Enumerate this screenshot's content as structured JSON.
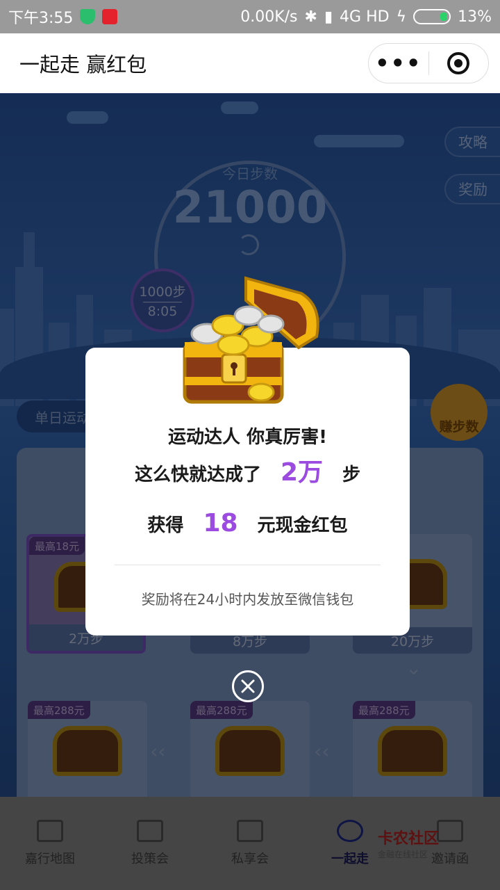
{
  "status_bar": {
    "time": "下午3:55",
    "network_speed": "0.00K/s",
    "network_type": "4G HD",
    "battery": "13%"
  },
  "title_bar": {
    "title": "一起走 赢红包",
    "more_icon": "more-dots-icon",
    "close_icon": "target-close-icon"
  },
  "background": {
    "step_label": "今日步数",
    "step_count": "21000",
    "side_buttons": [
      "攻略",
      "奖励"
    ],
    "milestone_steps": "1000步",
    "milestone_time": "8:05",
    "tab_label": "单日运动",
    "earn_button": "赚步数",
    "chest_cards": [
      {
        "tag": "最高18元",
        "steps": "2万步"
      },
      {
        "tag": "",
        "steps": "8万步"
      },
      {
        "tag": "",
        "steps": "20万步"
      },
      {
        "tag": "最高288元",
        "steps": ""
      },
      {
        "tag": "最高288元",
        "steps": ""
      },
      {
        "tag": "最高288元",
        "steps": ""
      }
    ]
  },
  "tab_bar": {
    "items": [
      {
        "label": "嘉行地图",
        "icon": "map-icon"
      },
      {
        "label": "投策会",
        "icon": "group-icon"
      },
      {
        "label": "私享会",
        "icon": "chat-icon"
      },
      {
        "label": "一起走",
        "icon": "walk-icon"
      },
      {
        "label": "邀请函",
        "icon": "mail-icon"
      }
    ],
    "active_index": 3
  },
  "watermark": {
    "name": "卡农社区",
    "sub": "金融在线社区"
  },
  "dialog": {
    "line1": "运动达人 你真厉害!",
    "line2_prefix": "这么快就达成了",
    "line2_value": "2万",
    "line2_suffix": "步",
    "line3_prefix": "获得",
    "line3_value": "18",
    "line3_suffix": "元现金红包",
    "note": "奖励将在24小时内发放至微信钱包",
    "highlight_color": "#9b4be0"
  }
}
